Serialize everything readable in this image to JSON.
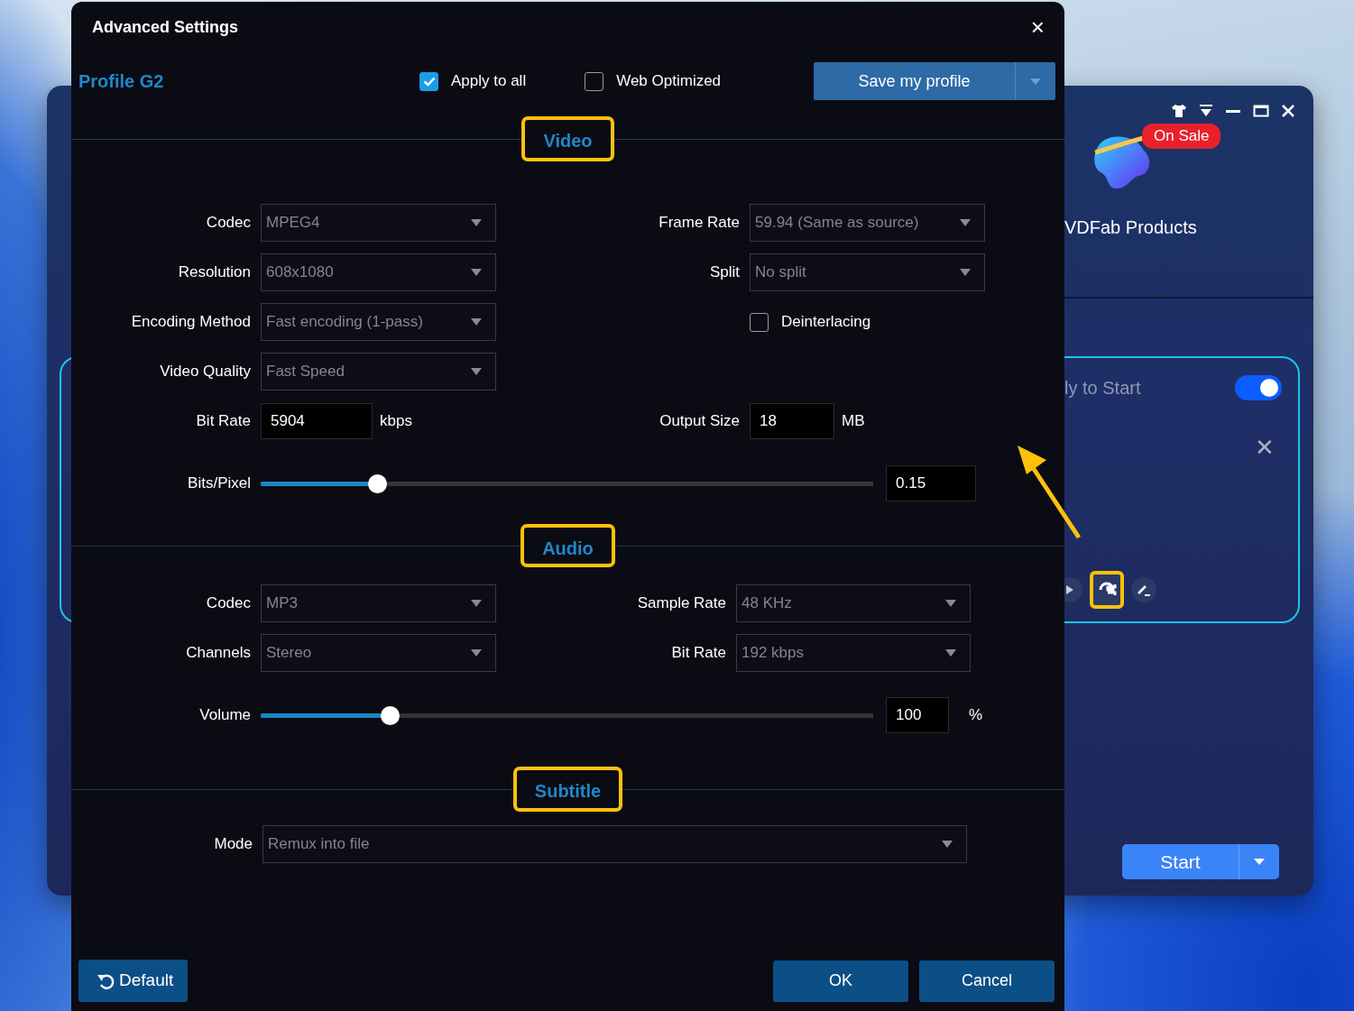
{
  "background_window": {
    "badge": "On Sale",
    "menu_label": "VDFab Products",
    "task": {
      "status": "ly to Start",
      "toggle_on": true,
      "settings_highlighted": true,
      "close": "✕"
    },
    "start_button": "Start"
  },
  "dialog": {
    "title": "Advanced Settings",
    "close": "×",
    "profile": "Profile G2",
    "options": [
      {
        "label": "Apply to all",
        "checked": true
      },
      {
        "label": "Web Optimized",
        "checked": false
      }
    ],
    "save_button": "Save my profile",
    "sections": [
      {
        "heading": "Video",
        "highlighted": true,
        "rows": [
          [
            {
              "kind": "select",
              "label": "Codec",
              "value": "MPEG4"
            },
            {
              "kind": "select",
              "label": "Frame Rate",
              "value": "59.94 (Same as source)"
            }
          ],
          [
            {
              "kind": "select",
              "label": "Resolution",
              "value": "608x1080"
            },
            {
              "kind": "select",
              "label": "Split",
              "value": "No split"
            }
          ],
          [
            {
              "kind": "select",
              "label": "Encoding Method",
              "value": "Fast encoding (1-pass)"
            },
            {
              "kind": "checkbox",
              "label": "Deinterlacing",
              "checked": false
            }
          ],
          [
            {
              "kind": "select",
              "label": "Video Quality",
              "value": "Fast Speed"
            }
          ],
          [
            {
              "kind": "input",
              "label": "Bit Rate",
              "value": "5904",
              "unit": "kbps"
            },
            {
              "kind": "input",
              "label": "Output Size",
              "value": "18",
              "unit": "MB"
            }
          ],
          [
            {
              "kind": "slider",
              "label": "Bits/Pixel",
              "level": 0.19,
              "value": "0.15"
            }
          ]
        ]
      },
      {
        "heading": "Audio",
        "highlighted": true,
        "rows": [
          [
            {
              "kind": "select",
              "label": "Codec",
              "value": "MP3"
            },
            {
              "kind": "select",
              "label": "Sample Rate",
              "value": "48 KHz"
            }
          ],
          [
            {
              "kind": "select",
              "label": "Channels",
              "value": "Stereo"
            },
            {
              "kind": "select",
              "label": "Bit Rate",
              "value": "192 kbps"
            }
          ],
          [
            {
              "kind": "slider",
              "label": "Volume",
              "level": 0.21,
              "value": "100",
              "unit": "%"
            }
          ]
        ]
      },
      {
        "heading": "Subtitle",
        "highlighted": true,
        "rows": [
          [
            {
              "kind": "wide-select",
              "label": "Mode",
              "value": "Remux into file"
            }
          ]
        ]
      }
    ],
    "default_button": "Default",
    "ok_button": "OK",
    "cancel_button": "Cancel"
  }
}
